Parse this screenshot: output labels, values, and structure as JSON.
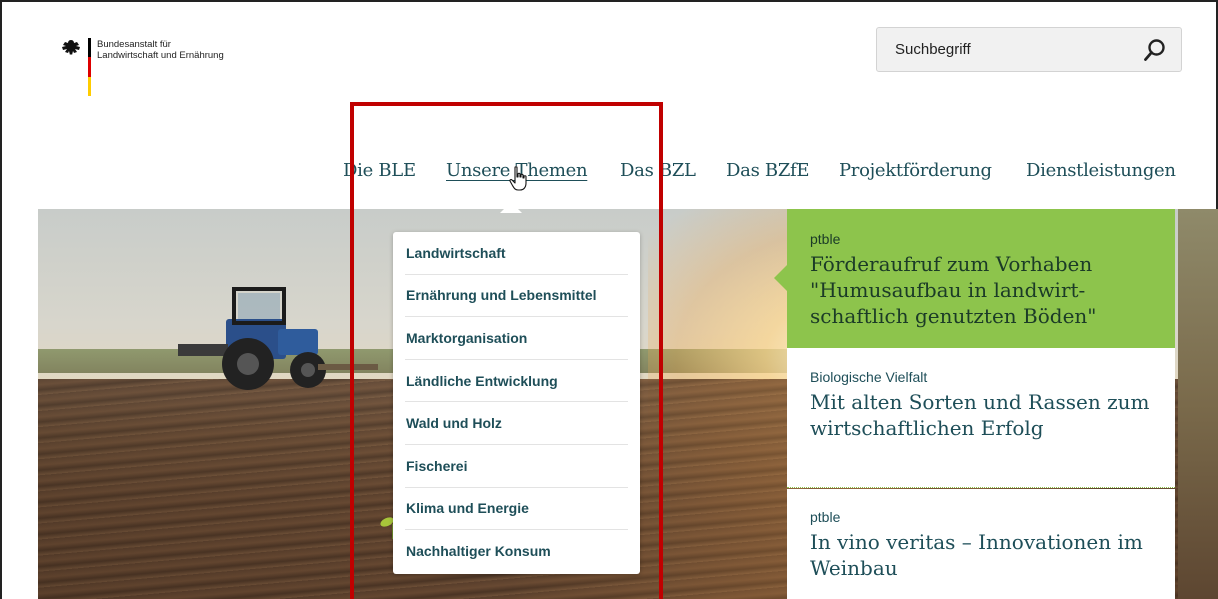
{
  "header": {
    "logo_line1": "Bundesanstalt für",
    "logo_line2": "Landwirtschaft und Ernährung",
    "search_placeholder": "Suchbegriff"
  },
  "nav": {
    "items": [
      "Die BLE",
      "Unsere Themen",
      "Das BZL",
      "Das BZfE",
      "Projektförderung",
      "Dienstleistungen"
    ],
    "active": "Unsere Themen"
  },
  "dropdown": {
    "items": [
      "Landwirtschaft",
      "Ernährung und Lebensmittel",
      "Marktorganisation",
      "Ländliche Entwicklung",
      "Wald und Holz",
      "Fischerei",
      "Klima und Energie",
      "Nachhaltiger Konsum"
    ]
  },
  "news": [
    {
      "kicker": "ptble",
      "headline": "Förderaufruf zum Vorhaben \"Humusaufbau in landwirt-schaftlich genutzten Böden\""
    },
    {
      "kicker": "Biologische Vielfalt",
      "headline": "Mit alten Sorten und Rassen zum wirtschaftlichen Erfolg"
    },
    {
      "kicker": "ptble",
      "headline": "In vino veritas – Innovationen im Weinbau"
    }
  ],
  "colors": {
    "brand_text": "#1e4e58",
    "accent_green": "#8dc44c",
    "highlight_red": "#c00000",
    "flag_black": "#000000",
    "flag_red": "#dd0000",
    "flag_gold": "#ffcc00"
  },
  "icons": {
    "search": "magnifier-icon",
    "cursor": "hand-pointer-icon",
    "eagle": "federal-eagle-icon"
  }
}
